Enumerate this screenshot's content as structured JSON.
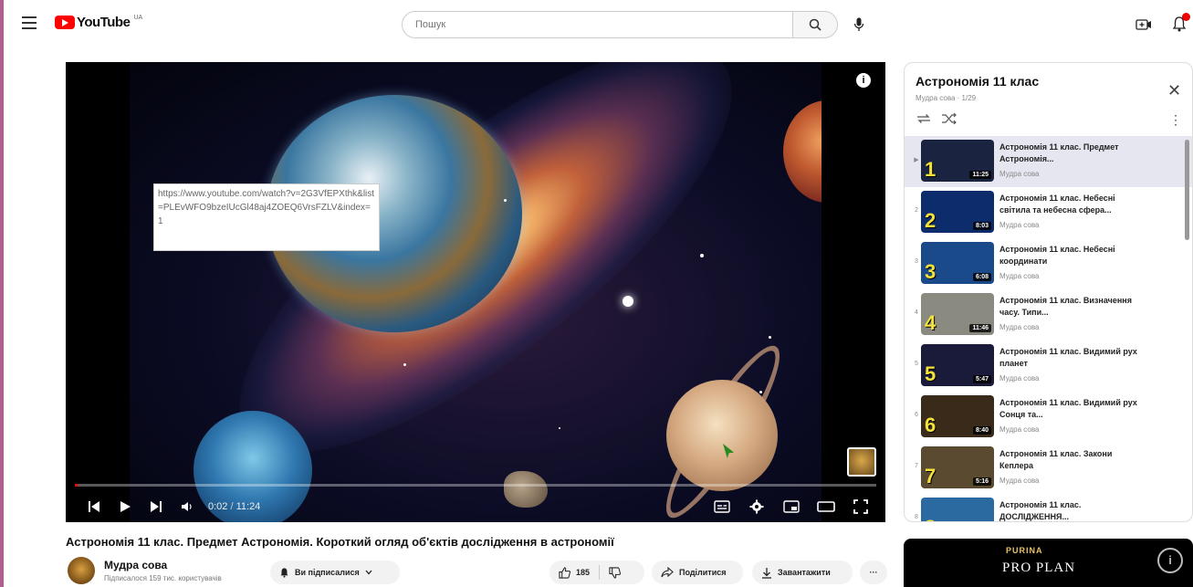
{
  "header": {
    "logo_text": "YouTube",
    "logo_country": "UA",
    "search_placeholder": "Пошук"
  },
  "player": {
    "url_overlay": "https://www.youtube.com/watch?v=2G3VfEPXthk&list=PLEvWFO9bzeIUcGl48aj4ZOEQ6VrsFZLV&index=1",
    "time_current": "0:02",
    "time_separator": " / ",
    "time_total": "11:24",
    "progress_fraction": 0.003
  },
  "video": {
    "title": "Астрономія 11 клас. Предмет Астрономія. Короткий огляд об'єктів дослідження в астрономії",
    "channel_name": "Мудра сова",
    "subscribers": "Підписалося 159 тис. користувачів",
    "subscribe_label": "Ви підписалися",
    "likes": "185",
    "share_label": "Поділитися",
    "download_label": "Завантажити",
    "more_label": "···"
  },
  "playlist": {
    "title": "Астрономія 11 клас",
    "meta": "Мудра сова · 1/29",
    "close_label": "✕",
    "menu_label": "⋮",
    "items": [
      {
        "index": "▶",
        "num": "1",
        "duration": "11:25",
        "title": "Астрономія 11 клас. Предмет Астрономія...",
        "channel": "Мудра сова",
        "thumb": "#1a2440"
      },
      {
        "index": "2",
        "num": "2",
        "duration": "8:03",
        "title": "Астрономія 11 клас. Небесні світила та небесна сфера...",
        "channel": "Мудра сова",
        "thumb": "#0c2c6c"
      },
      {
        "index": "3",
        "num": "3",
        "duration": "6:08",
        "title": "Астрономія 11 клас. Небесні координати",
        "channel": "Мудра сова",
        "thumb": "#1a4a8a"
      },
      {
        "index": "4",
        "num": "4",
        "duration": "11:46",
        "title": "Астрономія 11 клас. Визначення часу. Типи...",
        "channel": "Мудра сова",
        "thumb": "#8a8a80"
      },
      {
        "index": "5",
        "num": "5",
        "duration": "5:47",
        "title": "Астрономія 11 клас. Видимий рух планет",
        "channel": "Мудра сова",
        "thumb": "#1a1a3a"
      },
      {
        "index": "6",
        "num": "6",
        "duration": "8:40",
        "title": "Астрономія 11 клас. Видимий рух Сонця та...",
        "channel": "Мудра сова",
        "thumb": "#3a2a1a"
      },
      {
        "index": "7",
        "num": "7",
        "duration": "5:16",
        "title": "Астрономія 11 клас. Закони Кеплера",
        "channel": "Мудра сова",
        "thumb": "#5a4a30"
      },
      {
        "index": "8",
        "num": "8",
        "duration": "",
        "title": "Астрономія 11 клас. ДОСЛІДЖЕННЯ...",
        "channel": "",
        "thumb": "#2a6aa0"
      }
    ]
  },
  "ad": {
    "brand": "PURINA",
    "text": "PRO PLAN",
    "info_label": "i"
  },
  "colors": {
    "accent": "#ff0000",
    "playlist_active_bg": "#e6e6f0",
    "thumb_number": "#f3e23a"
  }
}
